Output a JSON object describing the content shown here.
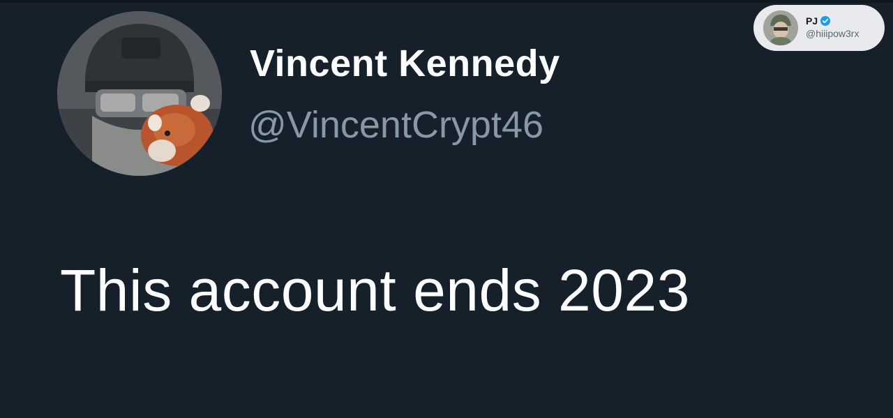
{
  "tweet": {
    "display_name": "Vincent Kennedy",
    "handle": "@VincentCrypt46",
    "text": "This account ends 2023"
  },
  "watermark": {
    "name": "PJ",
    "handle": "@hiiipow3rx",
    "verified": true
  },
  "colors": {
    "background": "#15202b",
    "name": "#ffffff",
    "handle": "#8899a6",
    "verified": "#1d9bf0"
  },
  "icons": {
    "avatar": "profile-photo",
    "watermark_avatar": "profile-photo",
    "verified": "verified-badge-icon"
  }
}
